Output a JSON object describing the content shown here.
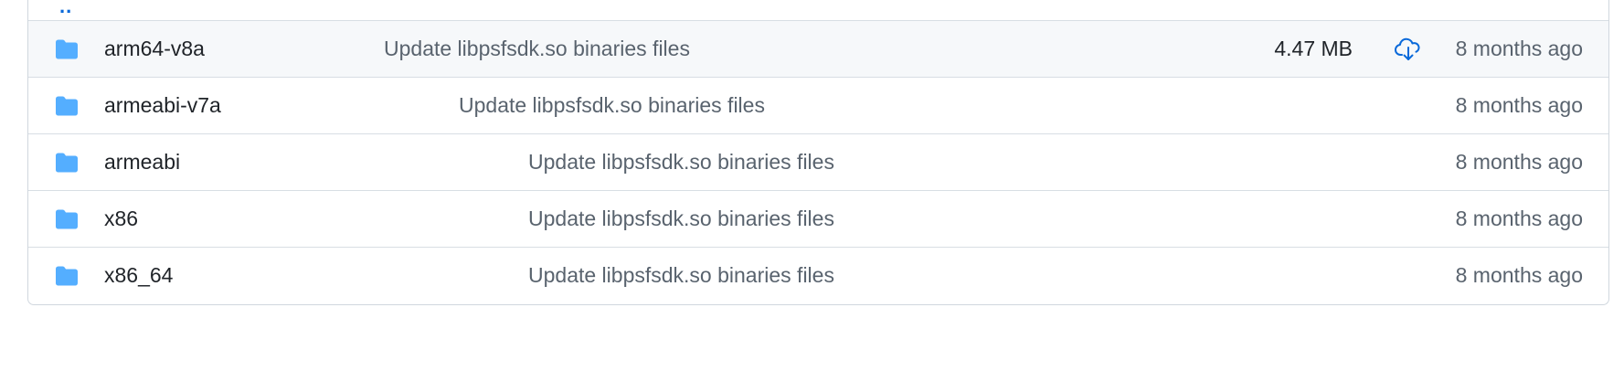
{
  "rows": [
    {
      "name": "arm64-v8a",
      "message": "Update libpsfsdk.so binaries files",
      "size": "4.47 MB",
      "age": "8 months ago"
    },
    {
      "name": "armeabi-v7a",
      "message": "Update libpsfsdk.so binaries files",
      "age": "8 months ago"
    },
    {
      "name": "armeabi",
      "message": "Update libpsfsdk.so binaries files",
      "age": "8 months ago"
    },
    {
      "name": "x86",
      "message": "Update libpsfsdk.so binaries files",
      "age": "8 months ago"
    },
    {
      "name": "x86_64",
      "message": "Update libpsfsdk.so binaries files",
      "age": "8 months ago"
    }
  ],
  "parent_link": "..",
  "icons": {
    "folder": "folder-icon",
    "download": "cloud-download-icon"
  },
  "colors": {
    "folder": "#54aeff",
    "link": "#0969da",
    "muted": "#59636e",
    "border": "#d0d7de"
  }
}
